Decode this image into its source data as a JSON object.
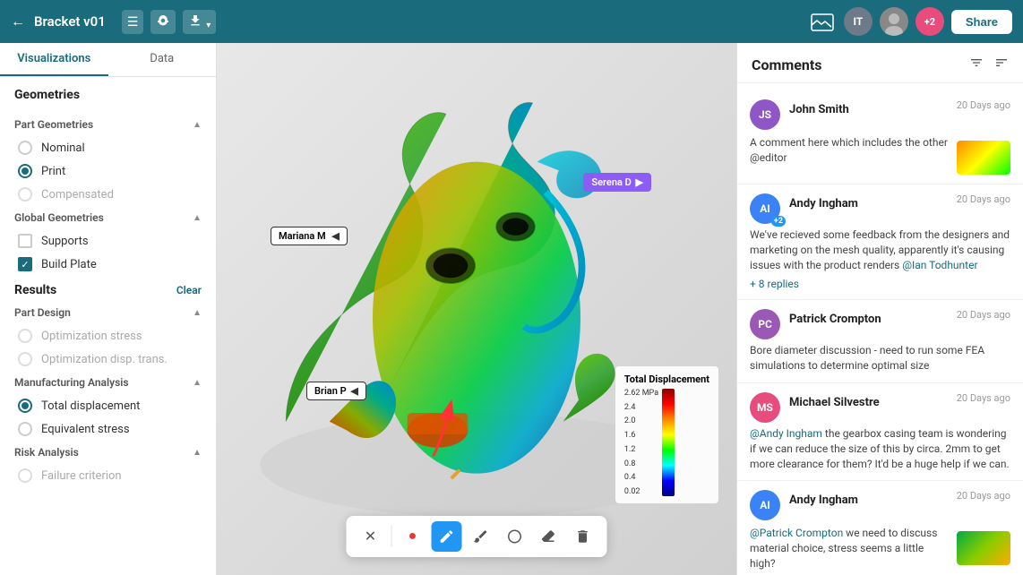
{
  "header": {
    "back_icon": "←",
    "title": "Bracket v01",
    "list_icon": "☰",
    "camera_icon": "📷",
    "download_icon": "⬇",
    "share_label": "Share",
    "avatars": [
      {
        "initials": "IT",
        "class": "avatar-it"
      },
      {
        "initials": "photo",
        "class": "avatar-photo"
      },
      {
        "initials": "+2",
        "class": "avatar-count"
      }
    ]
  },
  "sidebar": {
    "tabs": [
      "Visualizations",
      "Data"
    ],
    "geometries_title": "Geometries",
    "part_geometries_label": "Part Geometries",
    "global_geometries_label": "Global Geometries",
    "part_geom_items": [
      {
        "label": "Nominal",
        "selected": false,
        "disabled": false
      },
      {
        "label": "Print",
        "selected": true,
        "disabled": false
      },
      {
        "label": "Compensated",
        "selected": false,
        "disabled": true
      }
    ],
    "global_geom_items": [
      {
        "label": "Supports",
        "checked": false
      },
      {
        "label": "Build Plate",
        "checked": true
      }
    ],
    "results_title": "Results",
    "results_clear": "Clear",
    "part_design_label": "Part Design",
    "part_design_items": [
      {
        "label": "Optimization stress",
        "selected": false,
        "disabled": true
      },
      {
        "label": "Optimization disp. trans.",
        "selected": false,
        "disabled": true
      }
    ],
    "manufacturing_label": "Manufacturing Analysis",
    "manufacturing_items": [
      {
        "label": "Total displacement",
        "selected": true,
        "disabled": false
      },
      {
        "label": "Equivalent stress",
        "selected": false,
        "disabled": false
      }
    ],
    "risk_label": "Risk Analysis",
    "risk_items": [
      {
        "label": "Failure criterion",
        "selected": false,
        "disabled": true
      }
    ]
  },
  "viewport": {
    "annotation_mariana": "Mariana M",
    "annotation_serena": "Serena D",
    "annotation_brian": "Brian P",
    "legend_title": "Total Displacement",
    "legend_values": [
      "2.62 MPa",
      "2.4",
      "2.0",
      "1.6",
      "1.2",
      "0.8",
      "0.4",
      "0.02"
    ]
  },
  "toolbar": {
    "tools": [
      {
        "icon": "✕",
        "name": "close-tool",
        "active": false
      },
      {
        "icon": "●",
        "name": "dot-tool",
        "active": false,
        "red": true
      },
      {
        "icon": "✏",
        "name": "pencil-tool",
        "active": true
      },
      {
        "icon": "✒",
        "name": "pen-tool",
        "active": false
      },
      {
        "icon": "◌",
        "name": "shape-tool",
        "active": false
      },
      {
        "icon": "▬",
        "name": "erase-tool",
        "active": false
      },
      {
        "icon": "🗑",
        "name": "delete-tool",
        "active": false
      }
    ]
  },
  "comments": {
    "title": "Comments",
    "filter_icon": "▼",
    "sort_icon": "☰",
    "items": [
      {
        "id": "comment-js",
        "initials": "JS",
        "avatar_class": "av-js",
        "name": "John Smith",
        "time": "20 Days ago",
        "body": "A comment here which includes the other @editor",
        "has_thumbnail": true,
        "replies": null,
        "mention": null
      },
      {
        "id": "comment-ai1",
        "initials": "AI",
        "avatar_class": "av-ai",
        "name": "Andy Ingham",
        "time": "20 Days ago",
        "badge": "+2",
        "body": "We've recieved some feedback from the designers and marketing on the mesh quality, apparently it's causing issues with the product renders ",
        "mention": "@Ian Todhunter",
        "replies": "+ 8 replies",
        "has_thumbnail": false
      },
      {
        "id": "comment-pc",
        "initials": "PC",
        "avatar_class": "av-pc",
        "name": "Patrick Crompton",
        "time": "20 Days ago",
        "body": "Bore diameter discussion - need to run some FEA simulations to determine optimal size",
        "has_thumbnail": false,
        "replies": null,
        "mention": null
      },
      {
        "id": "comment-ms",
        "initials": "MS",
        "avatar_class": "av-ms",
        "name": "Michael Silvestre",
        "time": "20 Days ago",
        "body_prefix": "@Andy Ingham",
        "body": " the gearbox casing team is wondering if we can reduce the size of this by circa. 2mm to get more clearance for them? It'd be a huge help if we can.",
        "has_thumbnail": false,
        "replies": null,
        "mention": null
      },
      {
        "id": "comment-ai2",
        "initials": "AI",
        "avatar_class": "av-ai",
        "name": "Andy Ingham",
        "time": "20 Days ago",
        "body_prefix": "@Patrick Crompton",
        "body": " we need to discuss material choice, stress seems a little high?",
        "has_thumbnail": true,
        "replies": null,
        "mention": null
      }
    ]
  }
}
